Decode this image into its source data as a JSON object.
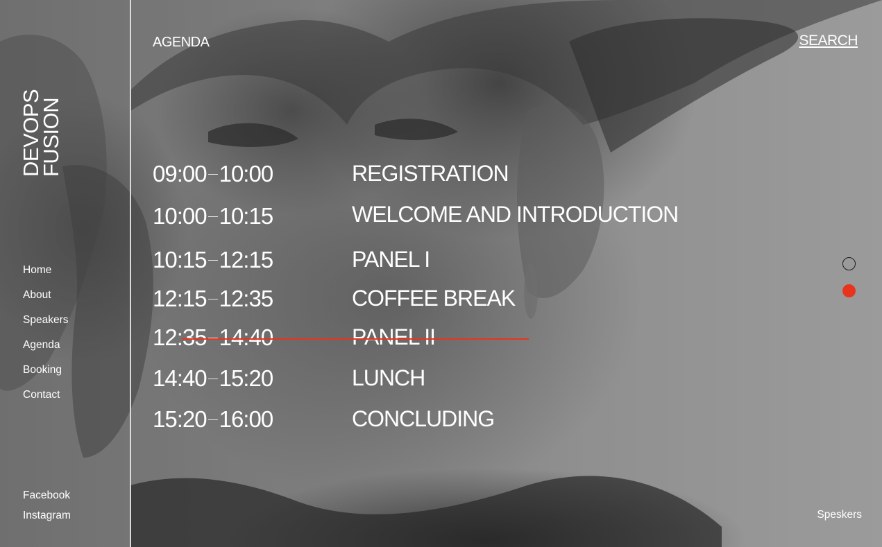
{
  "brand": {
    "line1": "DEVOPS",
    "line2": "FUSION"
  },
  "header": {
    "title": "AGENDA",
    "search_label": "SEARCH"
  },
  "nav": {
    "items": [
      {
        "label": "Home"
      },
      {
        "label": "About"
      },
      {
        "label": "Speakers"
      },
      {
        "label": "Agenda"
      },
      {
        "label": "Booking"
      },
      {
        "label": "Contact"
      }
    ]
  },
  "social": {
    "items": [
      {
        "label": "Facebook"
      },
      {
        "label": "Instagram"
      }
    ]
  },
  "agenda": {
    "active_index": 4,
    "items": [
      {
        "start": "09:00",
        "end": "10:00",
        "title": "REGISTRATION"
      },
      {
        "start": "10:00",
        "end": "10:15",
        "title": "WELCOME AND INTRODUCTION"
      },
      {
        "start": "10:15",
        "end": "12:15",
        "title": "PANEL I"
      },
      {
        "start": "12:15",
        "end": "12:35",
        "title": "COFFEE BREAK"
      },
      {
        "start": "12:35",
        "end": "14:40",
        "title": "PANEL II"
      },
      {
        "start": "14:40",
        "end": "15:20",
        "title": "LUNCH"
      },
      {
        "start": "15:20",
        "end": "16:00",
        "title": "CONCLUDING"
      }
    ]
  },
  "slider": {
    "dots": 2,
    "active_dot": 2
  },
  "footer": {
    "link_label": "Speskers"
  },
  "colors": {
    "accent": "#e8341c",
    "text": "#ffffff",
    "divider": "#d9d9d9"
  },
  "icons": {
    "slide_dot_inactive": "circle-outline-icon",
    "slide_dot_active": "circle-filled-icon"
  }
}
